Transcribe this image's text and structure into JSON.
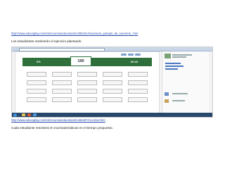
{
  "top": {
    "link": "http://www.educaplay.com/es/recursoseducativos/1465341/relacionar_parejas_de_numeros_.htm",
    "caption": "Los estudiantes resolverán el ejercicio planteado."
  },
  "screenshot": {
    "score_left": "0%",
    "score_center": "100",
    "score_right": "00:43"
  },
  "bottom": {
    "link": "http://www.educaplay.com/es/recursoseducativos/1465467/crucimat.htm",
    "caption": "Cada estudiante resolverá el crucimatemáticas en el tiempo propuesto."
  }
}
